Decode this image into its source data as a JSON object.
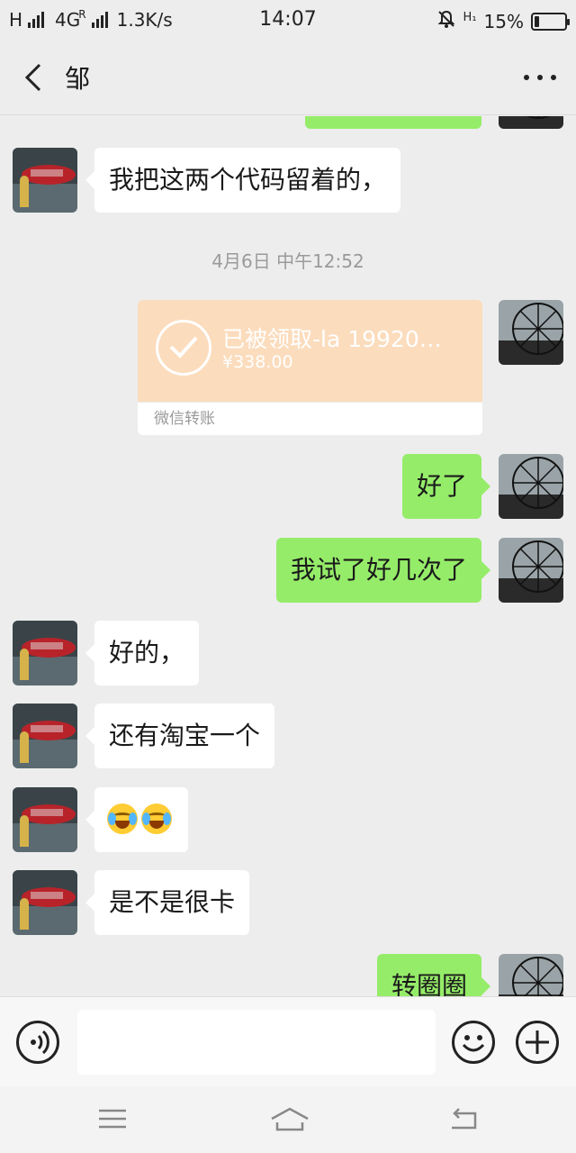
{
  "status_bar": {
    "network_left": "H",
    "network_4g": "4G",
    "roaming_mark": "R",
    "speed": "1.3K/s",
    "time": "14:07",
    "hd_mark": "H₁",
    "battery_percent": "15%",
    "battery_level": 0.15
  },
  "header": {
    "title": "邹",
    "back_icon": "chevron-left-icon",
    "more_icon": "more-dots-icon"
  },
  "messages": [
    {
      "side": "right",
      "type": "text",
      "text": "",
      "partial": true
    },
    {
      "side": "left",
      "type": "text",
      "text": "我把这两个代码留着的，"
    },
    {
      "type": "timestamp",
      "text": "4月6日 中午12:52"
    },
    {
      "side": "right",
      "type": "transfer",
      "description": "已被领取-la 199203…",
      "amount": "¥338.00",
      "footer": "微信转账"
    },
    {
      "side": "right",
      "type": "text",
      "text": "好了"
    },
    {
      "side": "right",
      "type": "text",
      "text": "我试了好几次了"
    },
    {
      "side": "left",
      "type": "text",
      "text": "好的，"
    },
    {
      "side": "left",
      "type": "text",
      "text": "还有淘宝一个"
    },
    {
      "side": "left",
      "type": "emoji",
      "emoji": [
        "loudly-crying-face",
        "loudly-crying-face"
      ]
    },
    {
      "side": "left",
      "type": "text",
      "text": "是不是很卡"
    },
    {
      "side": "right",
      "type": "text",
      "text": "转圈圈",
      "partial": true
    }
  ],
  "input_bar": {
    "voice_icon": "voice-icon",
    "text_value": "",
    "emoji_icon": "smiley-icon",
    "plus_icon": "plus-icon"
  },
  "system_nav": [
    "menu-icon",
    "home-icon",
    "back-icon"
  ],
  "colors": {
    "background": "#ededed",
    "bubble_self": "#95ec69",
    "bubble_other": "#ffffff",
    "transfer_card": "#fbdcbd"
  }
}
